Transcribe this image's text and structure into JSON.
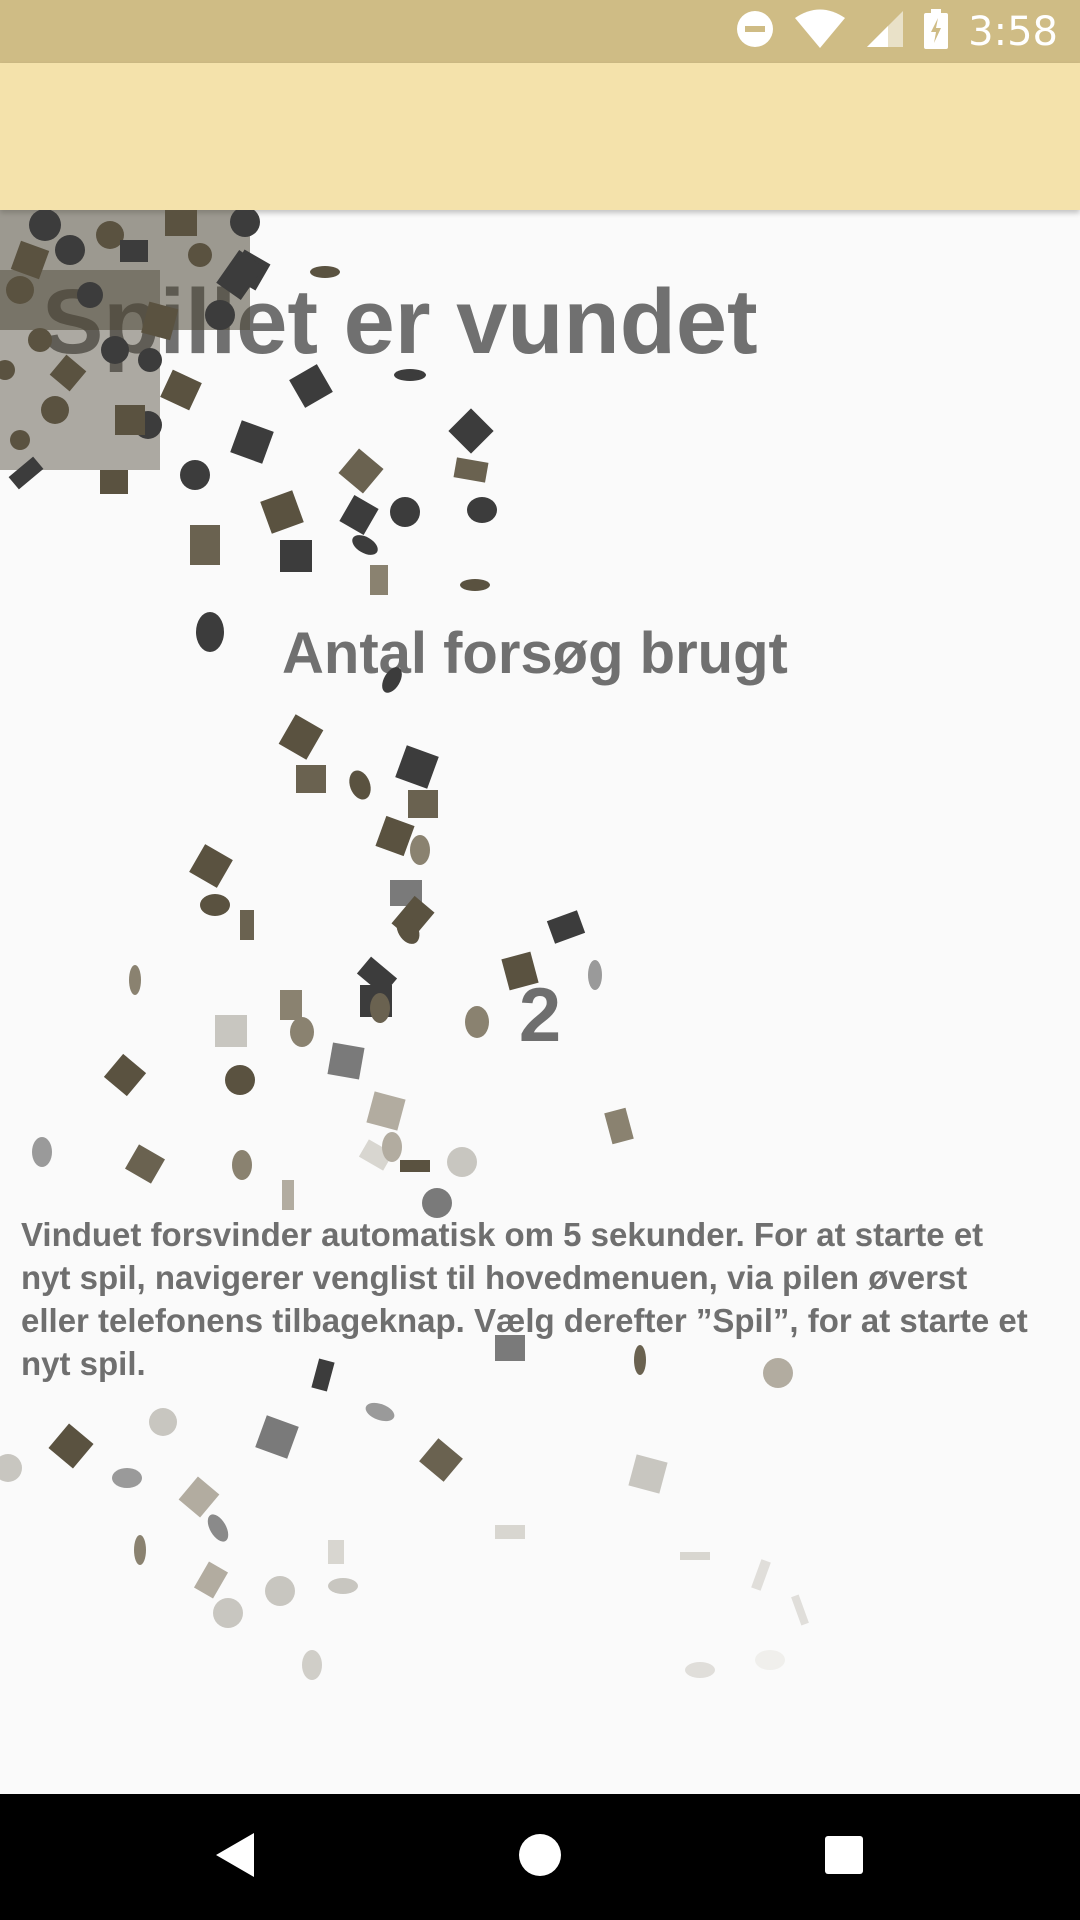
{
  "status_bar": {
    "time": "3:58",
    "icons": [
      "do-not-disturb-icon",
      "wifi-icon",
      "cell-signal-icon",
      "battery-charging-icon"
    ]
  },
  "app_bar": {
    "color": "#f4e2ab"
  },
  "content": {
    "title": "Spillet er vundet",
    "attempts_label": "Antal forsøg brugt",
    "attempts_value": "2",
    "message": "Vinduet forsvinder automatisk om 5 sekunder.  For at starte et nyt spil, navigerer venglist til hovedmenuen, via pilen øverst eller telefonens tilbageknap. Vælg derefter ”Spil”, for at starte et nyt spil."
  },
  "nav_bar": {
    "buttons": [
      "back-icon",
      "home-icon",
      "recents-icon"
    ]
  },
  "colors": {
    "status_bar": "#cfbc85",
    "app_bar": "#f4e2ab",
    "text": "#707070",
    "confetti": [
      "#3c3c3c",
      "#4e4838",
      "#5a5240",
      "#6a6250"
    ]
  }
}
